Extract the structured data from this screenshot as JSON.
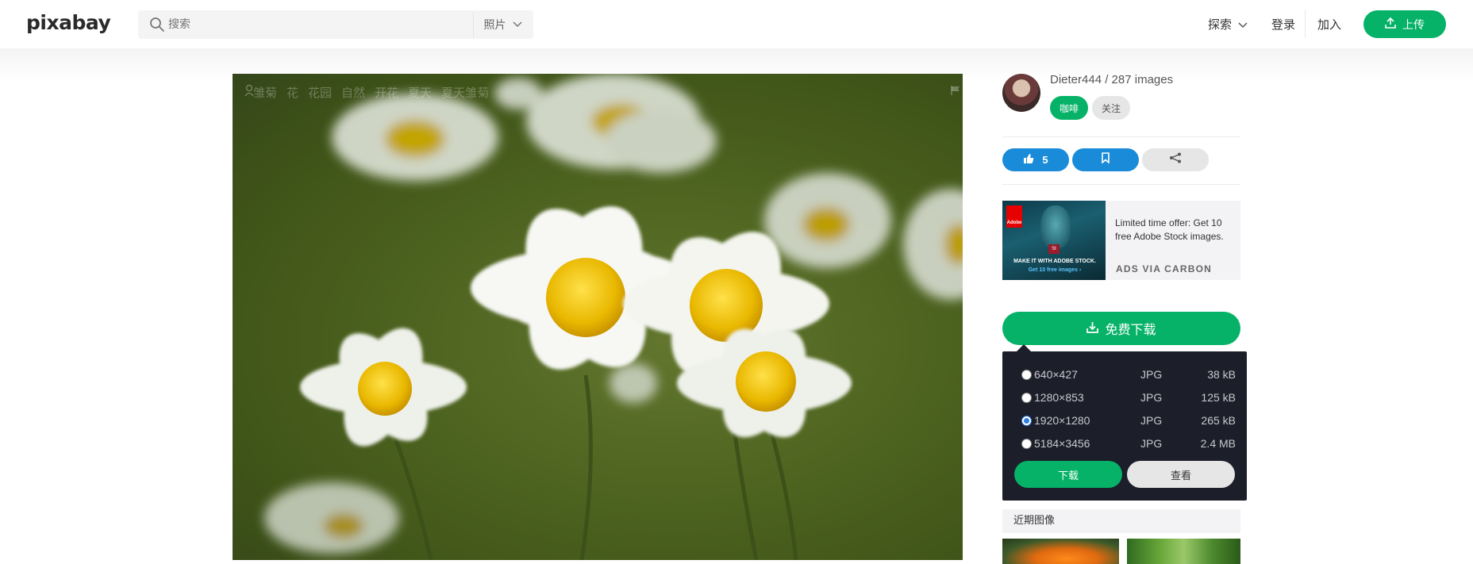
{
  "header": {
    "logo": "pixabay",
    "search_placeholder": "搜索",
    "search_type": "照片",
    "nav_explore": "探索",
    "nav_login": "登录",
    "nav_join": "加入",
    "upload_label": "上传"
  },
  "photo": {
    "tags": [
      "雏菊",
      "花",
      "花园",
      "自然",
      "开花",
      "夏天",
      "夏天雏菊"
    ]
  },
  "author": {
    "name_line": "Dieter444 / 287 images",
    "coffee_label": "咖啡",
    "follow_label": "关注"
  },
  "actions": {
    "likes": "5"
  },
  "ad": {
    "brand_tag": "Adobe",
    "badge": "St",
    "img_line1": "MAKE IT WITH ADOBE STOCK.",
    "img_line2": "Get 10 free images ›",
    "text": "Limited time offer: Get 10 free Adobe Stock images.",
    "via": "ADS VIA CARBON"
  },
  "download": {
    "main_label": "免费下载",
    "options": [
      {
        "res": "640×427",
        "fmt": "JPG",
        "size": "38 kB",
        "selected": false
      },
      {
        "res": "1280×853",
        "fmt": "JPG",
        "size": "125 kB",
        "selected": false
      },
      {
        "res": "1920×1280",
        "fmt": "JPG",
        "size": "265 kB",
        "selected": true
      },
      {
        "res": "5184×3456",
        "fmt": "JPG",
        "size": "2.4 MB",
        "selected": false
      }
    ],
    "download_label": "下载",
    "view_label": "查看"
  },
  "recent": {
    "title": "近期图像"
  },
  "colors": {
    "brand_green": "#05b267",
    "action_blue": "#1a8bd8",
    "panel_dark": "#1c1e2a"
  }
}
